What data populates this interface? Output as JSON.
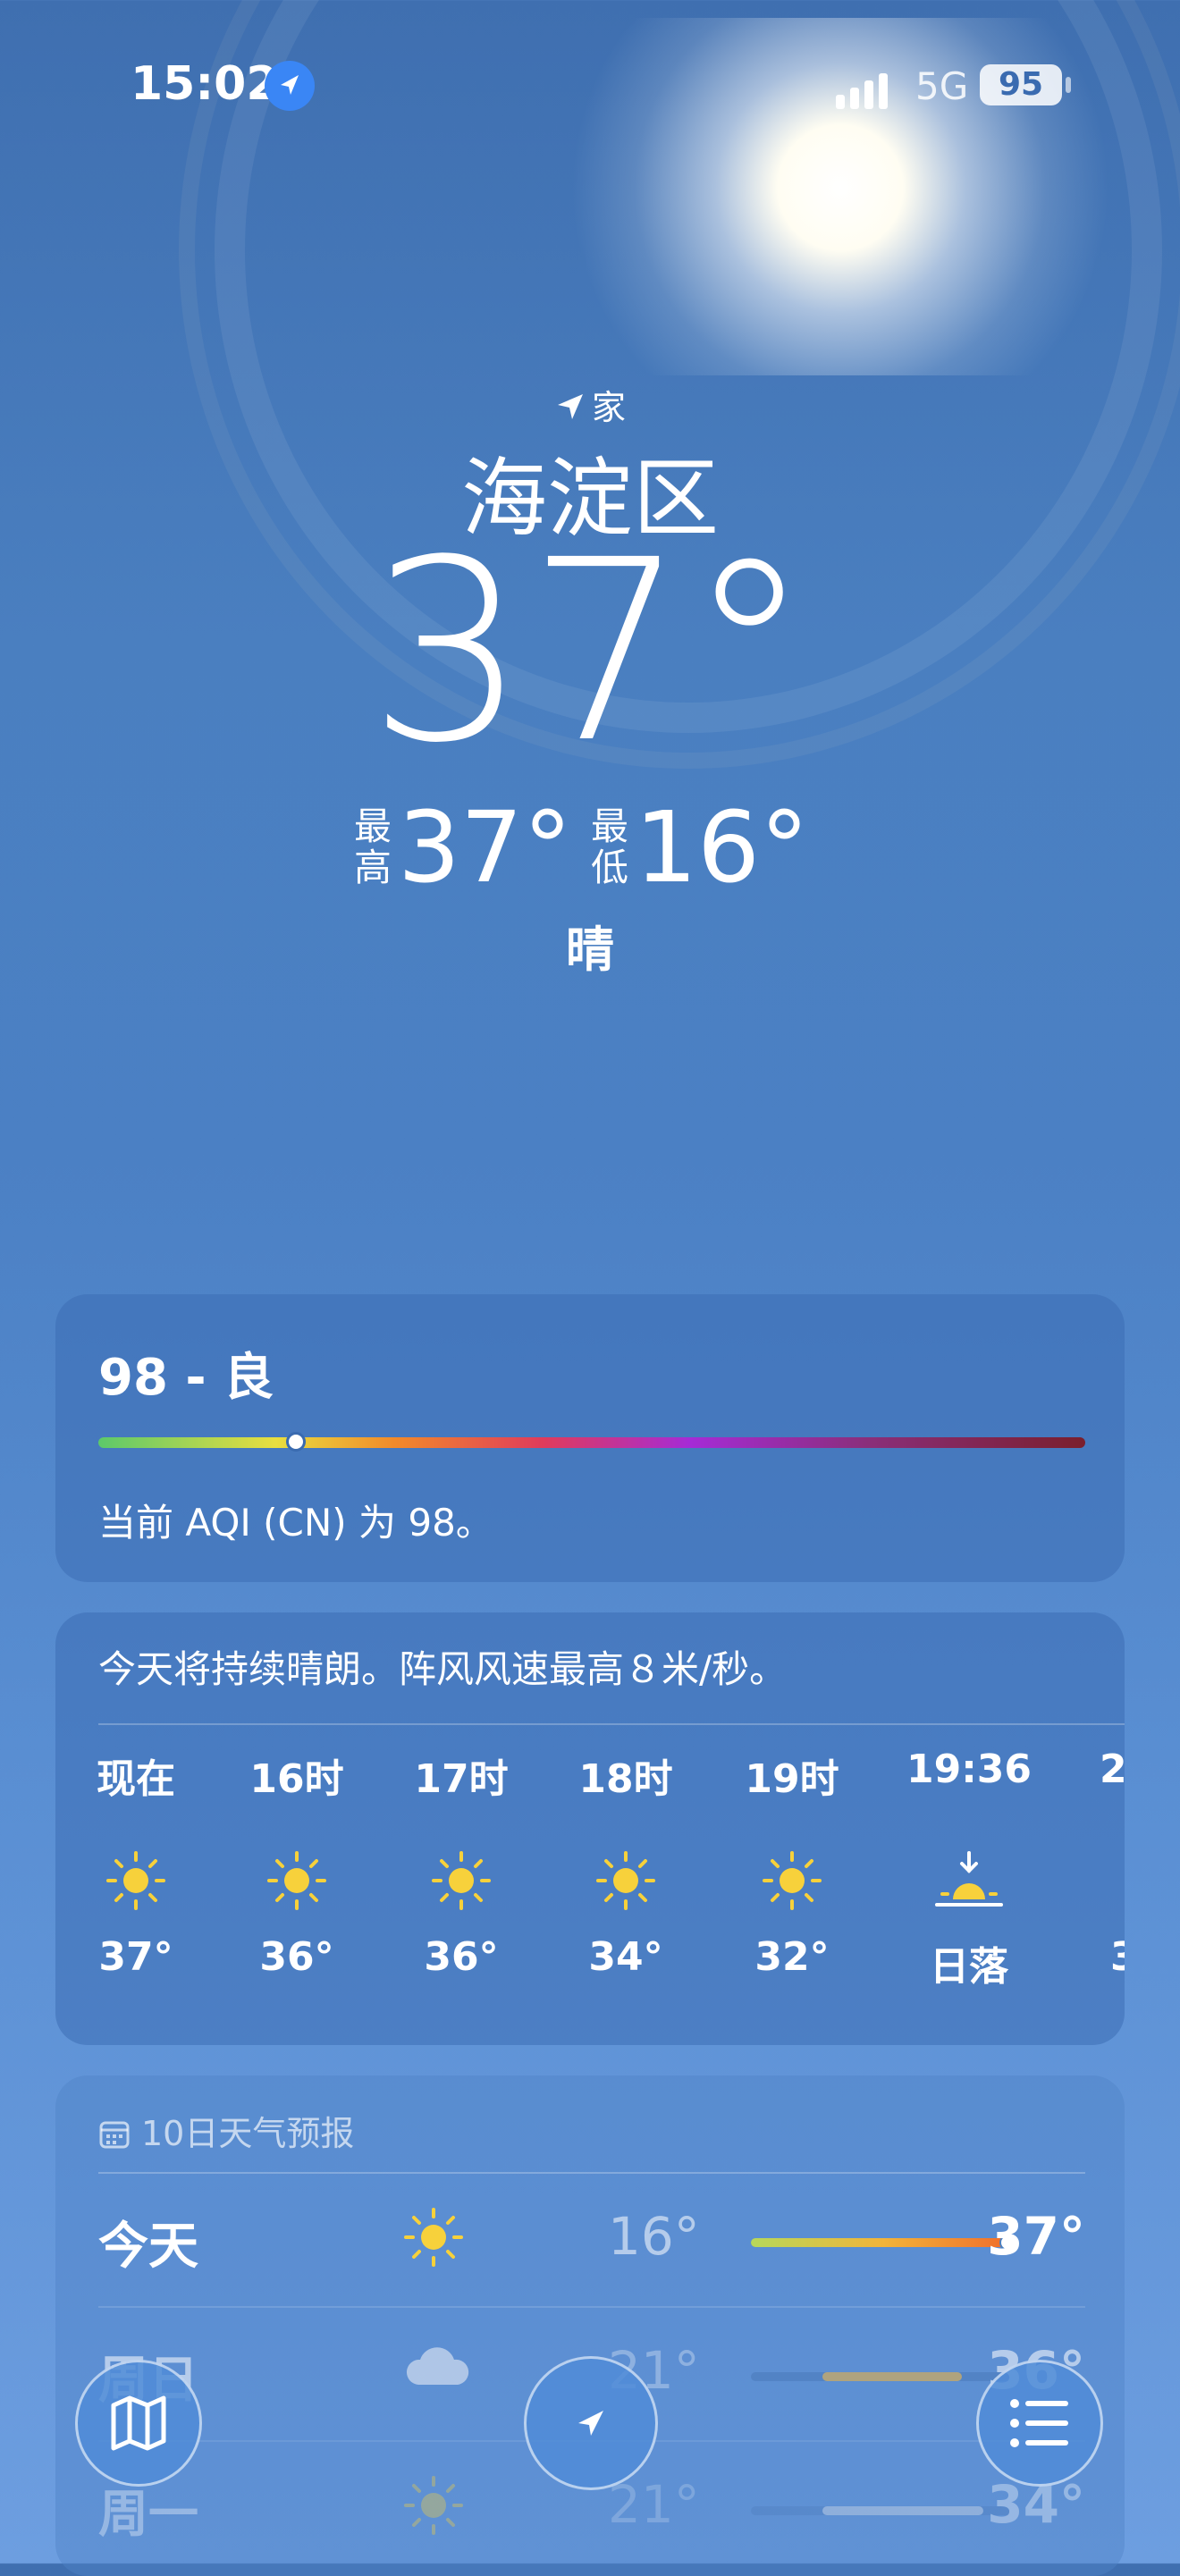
{
  "status": {
    "time": "15:02",
    "network": "5G",
    "battery": "95"
  },
  "location": {
    "tag": "家",
    "city": "海淀区"
  },
  "current": {
    "temp": "37°",
    "high_label": "最高",
    "high": "37°",
    "low_label": "最低",
    "low": "16°",
    "condition": "晴"
  },
  "aqi": {
    "value": "98 - 良",
    "level": 0.2,
    "description": "当前 AQI (CN) 为 98。"
  },
  "hourly": {
    "summary": "今天将持续晴朗。阵风风速最高８米/秒。",
    "items": [
      {
        "hour": "现在",
        "icon": "sun-icon",
        "temp": "37°"
      },
      {
        "hour": "16时",
        "icon": "sun-icon",
        "temp": "36°"
      },
      {
        "hour": "17时",
        "icon": "sun-icon",
        "temp": "36°"
      },
      {
        "hour": "18时",
        "icon": "sun-icon",
        "temp": "34°"
      },
      {
        "hour": "19时",
        "icon": "sun-icon",
        "temp": "32°"
      },
      {
        "hour": "19:36",
        "icon": "sunset-icon",
        "temp": "日落"
      },
      {
        "hour": "2",
        "icon": "sun-icon",
        "temp": "3"
      }
    ]
  },
  "daily": {
    "header": "10日天气预报",
    "days": [
      {
        "day": "今天",
        "icon": "sun-icon",
        "low": "16°",
        "high": "37°"
      },
      {
        "day": "周日",
        "icon": "cloud-icon",
        "low": "21°",
        "high": "36°"
      },
      {
        "day": "周一",
        "icon": "sun-icon",
        "low": "21°",
        "high": "34°"
      }
    ]
  },
  "colors": {
    "sun": "#f7d13b",
    "accent": "#3a86f5"
  },
  "nav": {
    "map": "map-icon",
    "location": "location-arrow-icon",
    "list": "list-icon"
  }
}
